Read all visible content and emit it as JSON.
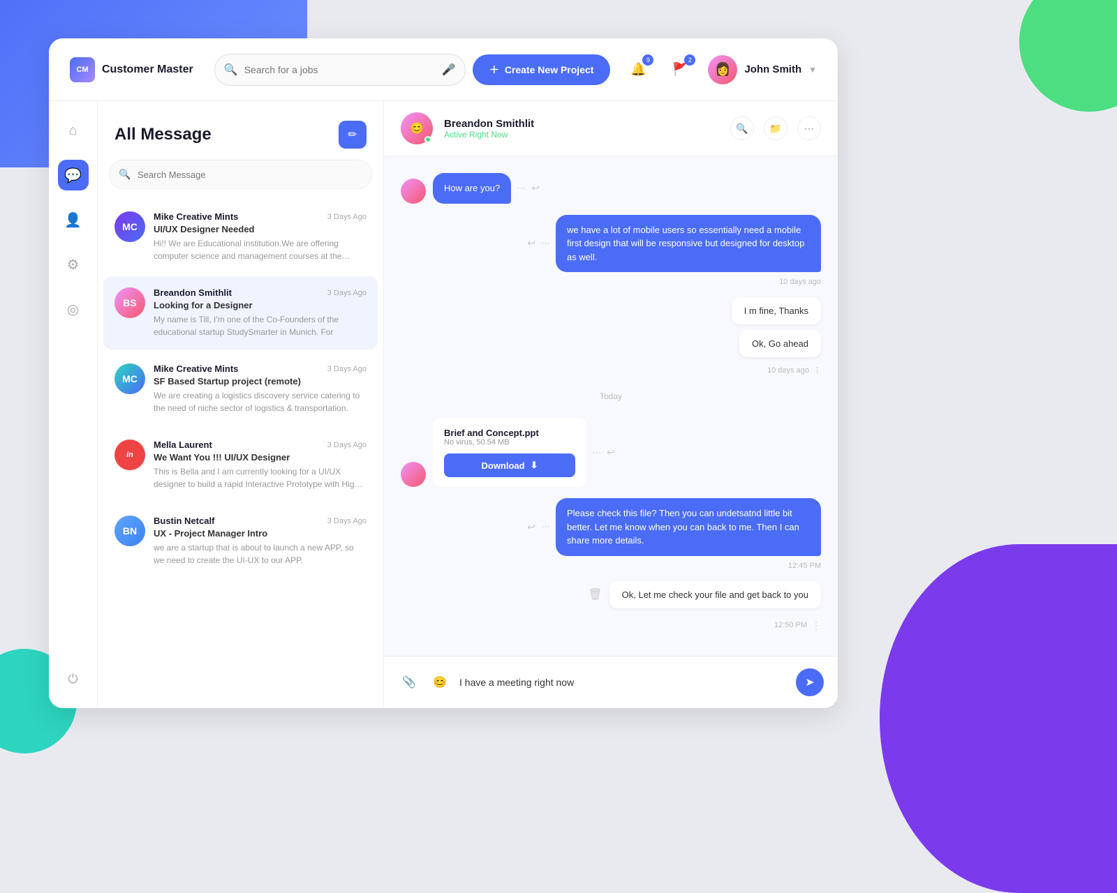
{
  "app": {
    "logo_text": "CM",
    "name": "Customer Master"
  },
  "header": {
    "search_placeholder": "Search for a jobs",
    "create_btn": "Create New Project",
    "notifications_count": "9",
    "alerts_count": "2",
    "user_name": "John Smith"
  },
  "sidebar": {
    "items": [
      {
        "id": "home",
        "icon": "⌂",
        "label": "Home"
      },
      {
        "id": "messages",
        "icon": "💬",
        "label": "Messages",
        "active": true
      },
      {
        "id": "profile",
        "icon": "👤",
        "label": "Profile"
      },
      {
        "id": "settings",
        "icon": "⚙",
        "label": "Settings"
      },
      {
        "id": "help",
        "icon": "◎",
        "label": "Help"
      },
      {
        "id": "logout",
        "icon": "⏻",
        "label": "Logout"
      }
    ]
  },
  "messages_panel": {
    "title": "All Message",
    "search_placeholder": "Search Message",
    "items": [
      {
        "sender": "Mike Creative Mints",
        "time": "3 Days Ago",
        "subject": "UI/UX Designer Needed",
        "preview": "Hi!! We are Educational institution.We are offering computer science and management courses at the present",
        "avatar_class": "av-purple",
        "avatar_initials": "MC"
      },
      {
        "sender": "Breandon Smithlit",
        "time": "3 Days Ago",
        "subject": "Looking for a Designer",
        "preview": "My name is Till, I'm one of the Co-Founders of the educational startup StudySmarter in Munich. For",
        "avatar_class": "av-pink",
        "avatar_initials": "BS",
        "active": true
      },
      {
        "sender": "Mike Creative Mints",
        "time": "3 Days Ago",
        "subject": "SF Based Startup project (remote)",
        "preview": "We are creating a logistics discovery service catering to the need of niche sector of logistics & transportation.",
        "avatar_class": "av-teal",
        "avatar_initials": "MC"
      },
      {
        "sender": "Mella Laurent",
        "time": "3 Days Ago",
        "subject": "We Want You !!! UI/UX Designer",
        "preview": "This is Bella and I am currently looking for a UI/UX designer to build a rapid Interactive Prototype with High-Fidelity by",
        "avatar_class": "av-red",
        "avatar_initials": "in"
      },
      {
        "sender": "Bustin Netcalf",
        "time": "3 Days Ago",
        "subject": "UX - Project Manager Intro",
        "preview": "we are a startup that is about to launch a new APP, so we need to create the UI-UX to our APP.",
        "avatar_class": "av-blue",
        "avatar_initials": "BN"
      }
    ]
  },
  "chat": {
    "contact_name": "Breandon Smithlit",
    "contact_status": "Active Right Now",
    "messages": [
      {
        "type": "received",
        "text": "How are you?",
        "time": ""
      },
      {
        "type": "sent",
        "text": "we have a lot of mobile users so essentially need a mobile first design that will be responsive but designed for desktop as well.",
        "time": "10 days ago"
      },
      {
        "type": "reply",
        "texts": [
          "I m fine, Thanks",
          "Ok, Go ahead"
        ],
        "time": "10 days ago"
      },
      {
        "type": "today_divider",
        "label": "Today"
      },
      {
        "type": "file",
        "file_name": "Brief and Concept.ppt",
        "file_meta": "No virus, 50.54 MB",
        "download_label": "Download"
      },
      {
        "type": "sent",
        "text": "Please check this file? Then you can undetsatnd little bit better. Let me know when you can back to me. Then I can share more details.",
        "time": "12:45 PM"
      }
    ],
    "last_reply": {
      "text": "Ok, Let me check your file and get back to you",
      "time": "12:50 PM"
    },
    "input_placeholder": "I have a meeting right now"
  }
}
